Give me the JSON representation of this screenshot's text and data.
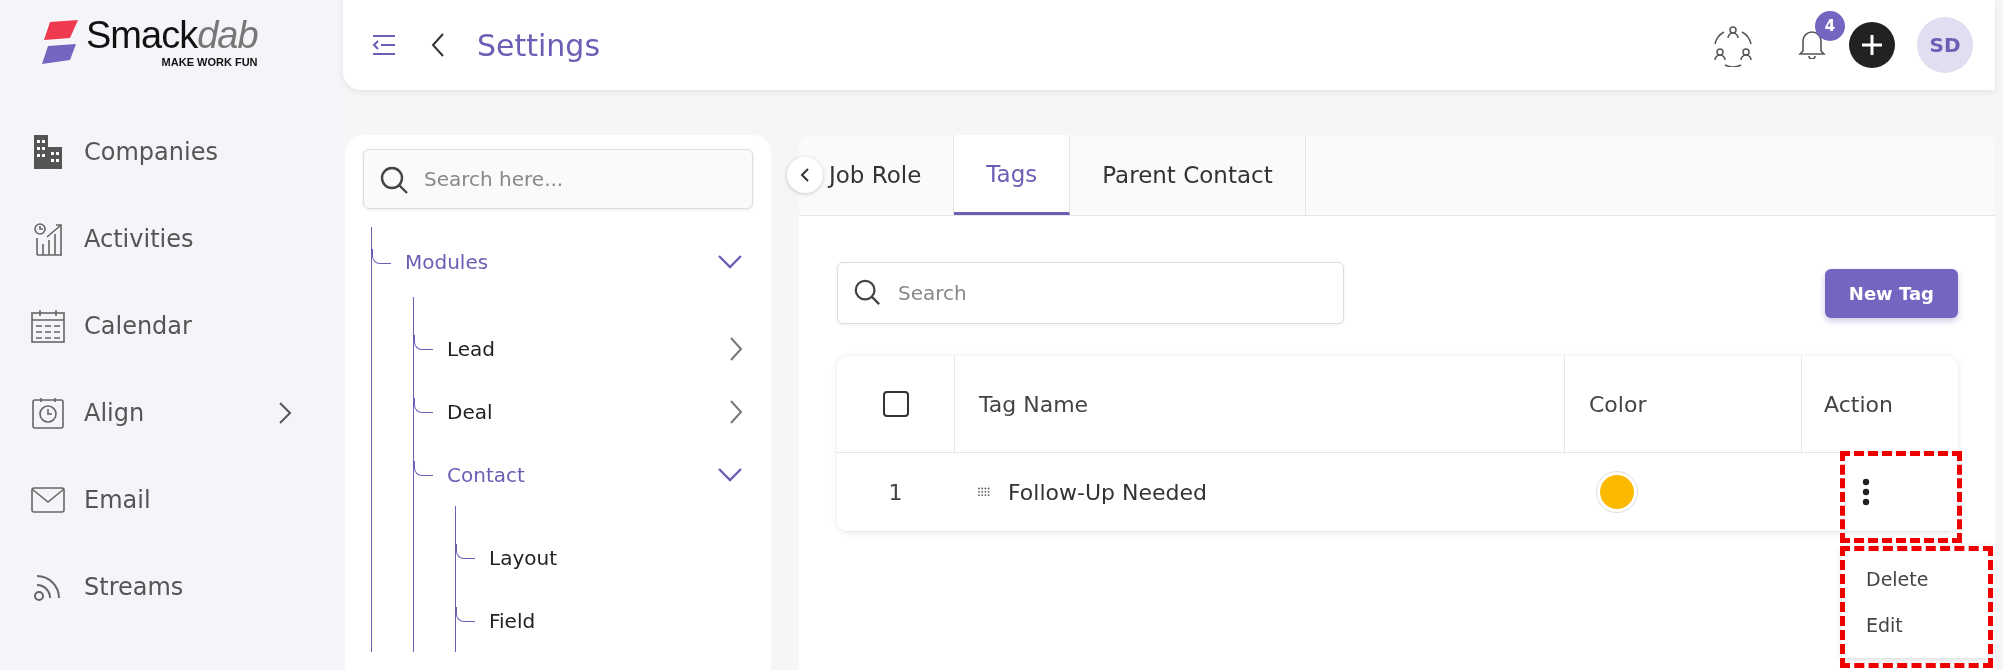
{
  "brand": {
    "name": "Smack",
    "name_accent": "dab",
    "tagline": "MAKE WORK FUN"
  },
  "sidebar": {
    "items": [
      {
        "label": "Companies",
        "has_submenu": false
      },
      {
        "label": "Activities",
        "has_submenu": false
      },
      {
        "label": "Calendar",
        "has_submenu": false
      },
      {
        "label": "Align",
        "has_submenu": true
      },
      {
        "label": "Email",
        "has_submenu": false
      },
      {
        "label": "Streams",
        "has_submenu": false
      }
    ]
  },
  "header": {
    "title": "Settings",
    "notification_count": "4",
    "avatar_initials": "SD"
  },
  "settings_tree": {
    "search_placeholder": "Search here...",
    "items": [
      {
        "label": "Modules",
        "expanded": true,
        "children": [
          {
            "label": "Lead",
            "expanded": false
          },
          {
            "label": "Deal",
            "expanded": false
          },
          {
            "label": "Contact",
            "expanded": true,
            "children": [
              {
                "label": "Layout"
              },
              {
                "label": "Field"
              }
            ]
          }
        ]
      }
    ]
  },
  "tabs": [
    {
      "label": "Job Role",
      "selected": false
    },
    {
      "label": "Tags",
      "selected": true
    },
    {
      "label": "Parent Contact",
      "selected": false
    }
  ],
  "search": {
    "placeholder": "Search"
  },
  "new_button": "New Tag",
  "table": {
    "columns": [
      "Tag Name",
      "Color",
      "Action"
    ],
    "select_all_checked": false,
    "rows": [
      {
        "index": "1",
        "name": "Follow-Up Needed",
        "color": "#fbb900"
      }
    ]
  },
  "action_menu": {
    "items": [
      "Delete",
      "Edit"
    ]
  }
}
